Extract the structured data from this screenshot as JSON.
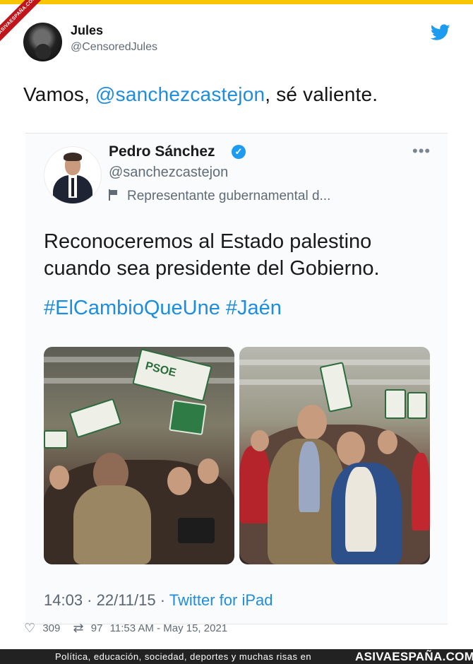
{
  "watermark": {
    "ribbon": "ASIVAESPAÑA.COM"
  },
  "author": {
    "name": "Jules",
    "handle": "@CensoredJules"
  },
  "tweet": {
    "prefix": "Vamos, ",
    "mention": "@sanchezcastejon",
    "suffix": ", sé valiente."
  },
  "quoted": {
    "name": "Pedro Sánchez",
    "verified_mark": "✓",
    "handle": "@sanchezcastejon",
    "label": "Representante gubernamental d...",
    "more": "•••",
    "text": "Reconoceremos al Estado palestino cuando sea presidente del Gobierno.",
    "hashtags": "#ElCambioQueUne #Jaén",
    "photos": [
      {
        "flag_text": "PSOE"
      },
      {
        "flag_text": ""
      }
    ],
    "time": "14:03 · 22/11/15 · ",
    "app": "Twitter for iPad"
  },
  "stats": {
    "likes": "309",
    "retweets": "97",
    "timestamp": "11:53 AM - May 15, 2021"
  },
  "footer": {
    "tagline": "Política, educación, sociedad, deportes y muchas risas en",
    "brand_main": "ASIVAESPAÑA.COM"
  },
  "icons": {
    "brand": "twitter-bird-icon",
    "like": "heart-icon",
    "retweet": "retweet-icon",
    "verified": "verified-badge-icon",
    "label": "flag-icon"
  },
  "colors": {
    "link": "#1d8ddf",
    "verified": "#1d9bf0",
    "footer_bg": "#222222",
    "ribbon": "#c0151a"
  }
}
